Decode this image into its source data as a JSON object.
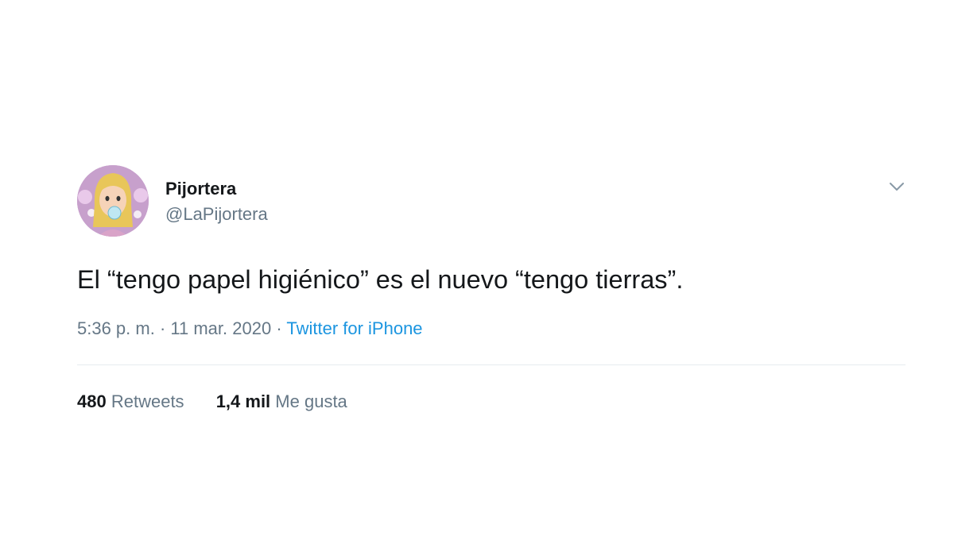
{
  "tweet": {
    "user": {
      "display_name": "Pijortera",
      "handle": "@LaPijortera",
      "avatar_icon": "cartoon-girl-face-avatar"
    },
    "menu_icon": "chevron-down-icon",
    "text": "El “tengo papel higiénico” es el nuevo “tengo tierras”.",
    "meta": {
      "time": "5:36 p. m.",
      "separator": " · ",
      "date": "11 mar. 2020",
      "source": "Twitter for iPhone"
    },
    "stats": {
      "retweets": {
        "count": "480",
        "label": "Retweets"
      },
      "likes": {
        "count": "1,4 mil",
        "label": "Me gusta"
      }
    }
  },
  "colors": {
    "text_primary": "#14171a",
    "text_secondary": "#657786",
    "link": "#1b95e0",
    "divider": "#e6ecf0"
  }
}
